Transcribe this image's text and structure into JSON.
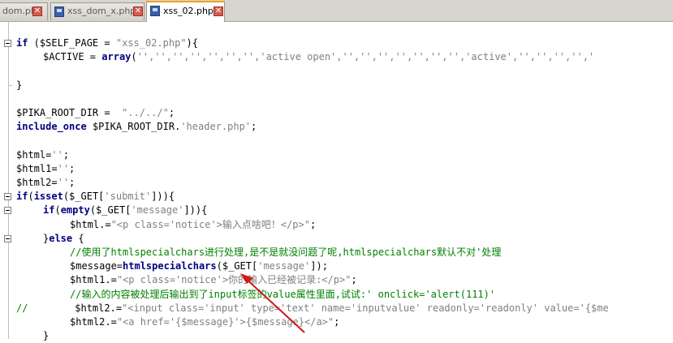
{
  "tabs": [
    {
      "label": "dom.php",
      "active": false
    },
    {
      "label": "xss_dom_x.php",
      "active": false
    },
    {
      "label": "xss_02.php",
      "active": true
    }
  ],
  "code_lines": [
    {
      "segments": [
        {
          "c": "kw",
          "t": "if"
        },
        {
          "c": "op",
          "t": " ("
        },
        {
          "c": "vr",
          "t": "$SELF_PAGE"
        },
        {
          "c": "op",
          "t": " = "
        },
        {
          "c": "st",
          "t": "\"xss_02.php\""
        },
        {
          "c": "op",
          "t": "){"
        }
      ]
    },
    {
      "segments": [
        {
          "c": "vr",
          "t": "$ACTIVE"
        },
        {
          "c": "op",
          "t": " = "
        },
        {
          "c": "kw",
          "t": "array"
        },
        {
          "c": "op",
          "t": "("
        },
        {
          "c": "st",
          "t": "'','','','','','','','active open','','','','','','','','active','','','','','"
        }
      ]
    },
    {
      "segments": []
    },
    {
      "segments": [
        {
          "c": "op",
          "t": "}"
        }
      ]
    },
    {
      "segments": []
    },
    {
      "segments": [
        {
          "c": "vr",
          "t": "$PIKA_ROOT_DIR"
        },
        {
          "c": "op",
          "t": " =  "
        },
        {
          "c": "st",
          "t": "\"../../\""
        },
        {
          "c": "op",
          "t": ";"
        }
      ]
    },
    {
      "segments": [
        {
          "c": "kw",
          "t": "include_once"
        },
        {
          "c": "op",
          "t": " "
        },
        {
          "c": "vr",
          "t": "$PIKA_ROOT_DIR"
        },
        {
          "c": "op",
          "t": "."
        },
        {
          "c": "st",
          "t": "'header.php'"
        },
        {
          "c": "op",
          "t": ";"
        }
      ]
    },
    {
      "segments": []
    },
    {
      "segments": [
        {
          "c": "vr",
          "t": "$html"
        },
        {
          "c": "op",
          "t": "="
        },
        {
          "c": "st",
          "t": "''"
        },
        {
          "c": "op",
          "t": ";"
        }
      ]
    },
    {
      "segments": [
        {
          "c": "vr",
          "t": "$html1"
        },
        {
          "c": "op",
          "t": "="
        },
        {
          "c": "st",
          "t": "''"
        },
        {
          "c": "op",
          "t": ";"
        }
      ]
    },
    {
      "segments": [
        {
          "c": "vr",
          "t": "$html2"
        },
        {
          "c": "op",
          "t": "="
        },
        {
          "c": "st",
          "t": "''"
        },
        {
          "c": "op",
          "t": ";"
        }
      ]
    },
    {
      "segments": [
        {
          "c": "kw",
          "t": "if"
        },
        {
          "c": "op",
          "t": "("
        },
        {
          "c": "kw",
          "t": "isset"
        },
        {
          "c": "op",
          "t": "("
        },
        {
          "c": "vr",
          "t": "$_GET"
        },
        {
          "c": "op",
          "t": "["
        },
        {
          "c": "st",
          "t": "'submit'"
        },
        {
          "c": "op",
          "t": "])){"
        }
      ]
    },
    {
      "segments": [
        {
          "c": "kw",
          "t": "if"
        },
        {
          "c": "op",
          "t": "("
        },
        {
          "c": "kw",
          "t": "empty"
        },
        {
          "c": "op",
          "t": "("
        },
        {
          "c": "vr",
          "t": "$_GET"
        },
        {
          "c": "op",
          "t": "["
        },
        {
          "c": "st",
          "t": "'message'"
        },
        {
          "c": "op",
          "t": "])){"
        }
      ]
    },
    {
      "segments": [
        {
          "c": "vr",
          "t": "$html"
        },
        {
          "c": "op",
          "t": ".="
        },
        {
          "c": "st",
          "t": "\"<p class='notice'>输入点啥吧！</p>\""
        },
        {
          "c": "op",
          "t": ";"
        }
      ]
    },
    {
      "segments": [
        {
          "c": "op",
          "t": "}"
        },
        {
          "c": "kw",
          "t": "else"
        },
        {
          "c": "op",
          "t": " {"
        }
      ]
    },
    {
      "segments": [
        {
          "c": "cm",
          "t": "//使用了htmlspecialchars进行处理,是不是就没问题了呢,htmlspecialchars默认不对'处理"
        }
      ]
    },
    {
      "segments": [
        {
          "c": "vr",
          "t": "$message"
        },
        {
          "c": "op",
          "t": "="
        },
        {
          "c": "kw",
          "t": "htmlspecialchars"
        },
        {
          "c": "op",
          "t": "("
        },
        {
          "c": "vr",
          "t": "$_GET"
        },
        {
          "c": "op",
          "t": "["
        },
        {
          "c": "st",
          "t": "'message'"
        },
        {
          "c": "op",
          "t": "]);"
        }
      ]
    },
    {
      "segments": [
        {
          "c": "vr",
          "t": "$html1"
        },
        {
          "c": "op",
          "t": ".="
        },
        {
          "c": "st",
          "t": "\"<p class='notice'>你的输入已经被记录:</p>\""
        },
        {
          "c": "op",
          "t": ";"
        }
      ]
    },
    {
      "segments": [
        {
          "c": "cm",
          "t": "//输入的内容被处理后输出到了input标签的value属性里面,试试:' onclick='alert(111)'"
        }
      ]
    },
    {
      "segments": [
        {
          "c": "cm",
          "t": "//        "
        },
        {
          "c": "vr",
          "t": "$html2"
        },
        {
          "c": "op",
          "t": ".="
        },
        {
          "c": "st",
          "t": "\"<input class='input' type='text' name='inputvalue' readonly='readonly' value='{$me"
        }
      ]
    },
    {
      "segments": [
        {
          "c": "vr",
          "t": "$html2"
        },
        {
          "c": "op",
          "t": ".="
        },
        {
          "c": "st",
          "t": "\"<a href='{$message}'>{$message}</a>\""
        },
        {
          "c": "op",
          "t": ";"
        }
      ]
    },
    {
      "segments": [
        {
          "c": "op",
          "t": "}"
        }
      ]
    }
  ]
}
